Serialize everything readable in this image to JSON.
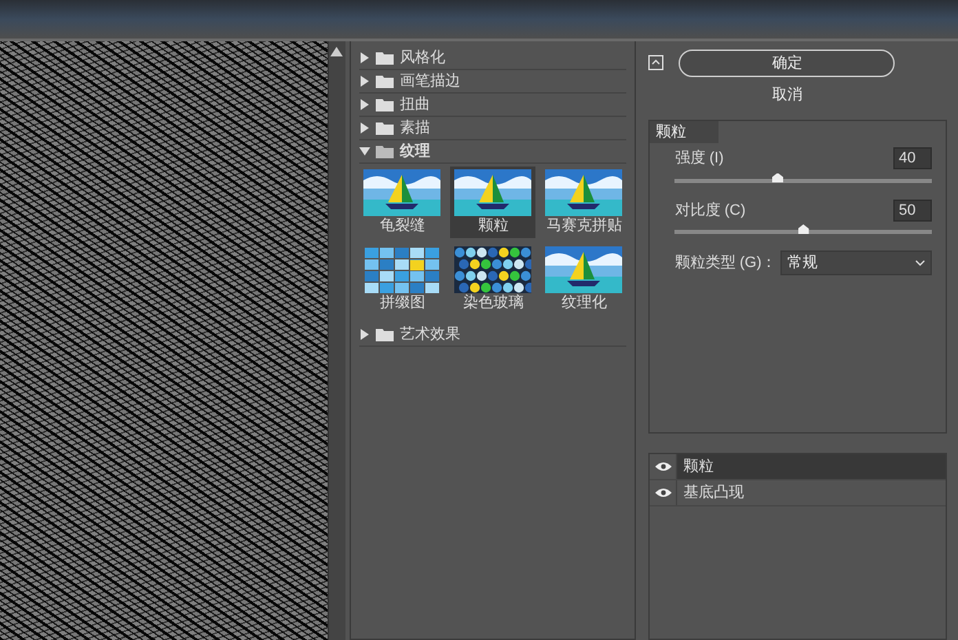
{
  "categories": [
    {
      "label": "风格化",
      "expanded": false
    },
    {
      "label": "画笔描边",
      "expanded": false
    },
    {
      "label": "扭曲",
      "expanded": false
    },
    {
      "label": "素描",
      "expanded": false
    },
    {
      "label": "纹理",
      "expanded": true,
      "filters": [
        {
          "label": "龟裂缝",
          "kind": "boat",
          "selected": false
        },
        {
          "label": "颗粒",
          "kind": "boat",
          "selected": true
        },
        {
          "label": "马赛克拼贴",
          "kind": "boat",
          "selected": false
        },
        {
          "label": "拼缀图",
          "kind": "tiles",
          "selected": false
        },
        {
          "label": "染色玻璃",
          "kind": "glass",
          "selected": false
        },
        {
          "label": "纹理化",
          "kind": "boat",
          "selected": false
        }
      ]
    },
    {
      "label": "艺术效果",
      "expanded": false
    }
  ],
  "ok_button": "确定",
  "cancel_button": "取消",
  "settings": {
    "title": "颗粒",
    "sliders": [
      {
        "label": "强度 (I)",
        "value": "40",
        "level": 0.4
      },
      {
        "label": "对比度 (C)",
        "value": "50",
        "level": 0.5
      }
    ],
    "grain_type": {
      "label": "颗粒类型 (G)：",
      "value": "常规"
    }
  },
  "effect_layers": [
    {
      "label": "颗粒",
      "visible": true,
      "selected": true
    },
    {
      "label": "基底凸现",
      "visible": true,
      "selected": false
    }
  ]
}
